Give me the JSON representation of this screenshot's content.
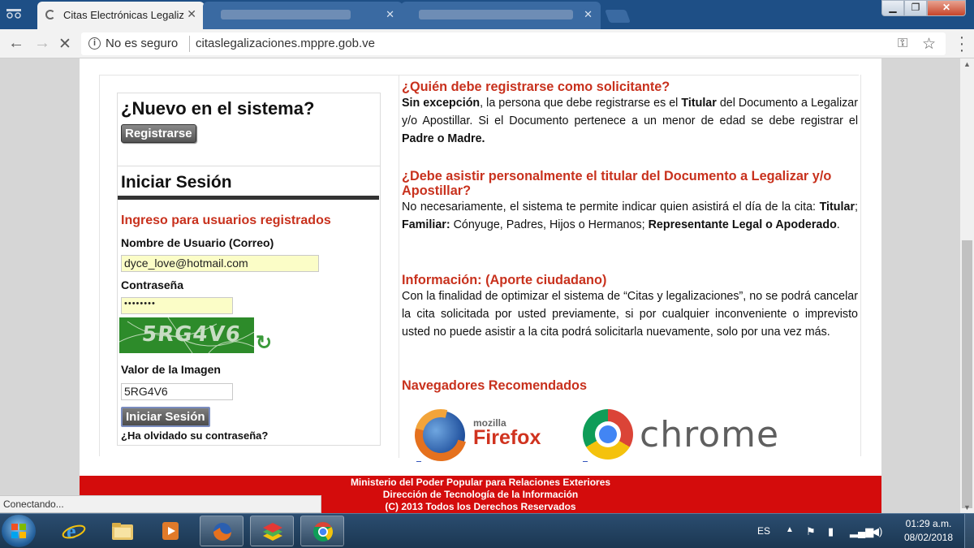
{
  "browser": {
    "tabs": [
      {
        "title": "Citas Electrónicas Legaliz",
        "active": true
      },
      {
        "title": "",
        "blurred": true
      },
      {
        "title": "",
        "blurred": true
      }
    ],
    "security_label": "No es seguro",
    "url": "citaslegalizaciones.mppre.gob.ve",
    "status_text": "Conectando..."
  },
  "sidebar": {
    "new_title": "¿Nuevo en el sistema?",
    "register_label": "Registrarse",
    "login_title": "Iniciar Sesión",
    "login_subtitle": "Ingreso para usuarios registrados",
    "username_label": "Nombre de Usuario (Correo)",
    "username_value": "dyce_love@hotmail.com",
    "password_label": "Contraseña",
    "password_value": "••••••••",
    "captcha_text": "5RG4V6",
    "image_value_label": "Valor de la Imagen",
    "image_value": "5RG4V6",
    "login_button": "Iniciar Sesión",
    "forgot_link": "¿Ha olvidado su contraseña?"
  },
  "content": {
    "sec1_title": "¿Quién debe registrarse como solicitante?",
    "sec1_p1": "Sin excepción",
    "sec1_p2": ", la persona que debe registrarse es el ",
    "sec1_p3": "Titular",
    "sec1_p4": " del Documento a Legalizar y/o Apostillar. Si el Documento pertenece a un menor de edad se debe registrar el ",
    "sec1_p5": "Padre o Madre.",
    "sec2_title": "¿Debe asistir personalmente el titular del Documento a Legalizar y/o Apostillar?",
    "sec2_p1": "No necesariamente, el sistema te permite indicar quien asistirá el día de la cita: ",
    "sec2_p2": "Titular",
    "sec2_p3": ";   ",
    "sec2_p4": "Familiar:",
    "sec2_p5": " Cónyuge, Padres, Hijos o Hermanos;   ",
    "sec2_p6": "Representante Legal o Apoderado",
    "sec2_p7": ".",
    "sec3_title": "Información: (Aporte ciudadano)",
    "sec3_body": "Con la finalidad de optimizar el sistema de “Citas y legalizaciones”, no se podrá cancelar la cita solicitada por usted previamente, si por cualquier inconveniente o imprevisto usted no puede asistir a la cita podrá solicitarla nuevamente, solo por una vez más.",
    "sec4_title": "Navegadores Recomendados",
    "firefox_small": "mozilla",
    "firefox_big": "Firefox",
    "chrome_text": "chrome"
  },
  "footer": {
    "line1": "Ministerio del Poder Popular para Relaciones Exteriores",
    "line2": "Dirección de Tecnología de la Información",
    "line3": "(C) 2013 Todos los Derechos Reservados"
  },
  "taskbar": {
    "language": "ES",
    "time": "01:29 a.m.",
    "date": "08/02/2018",
    "apps": [
      "internet-explorer",
      "file-explorer",
      "media-player",
      "firefox",
      "bluestacks",
      "chrome"
    ]
  },
  "colors": {
    "accent_red": "#c8311d",
    "footer_red": "#d40c0c",
    "titlebar_blue": "#1e4f86",
    "input_yellow": "#fbfdc7"
  }
}
